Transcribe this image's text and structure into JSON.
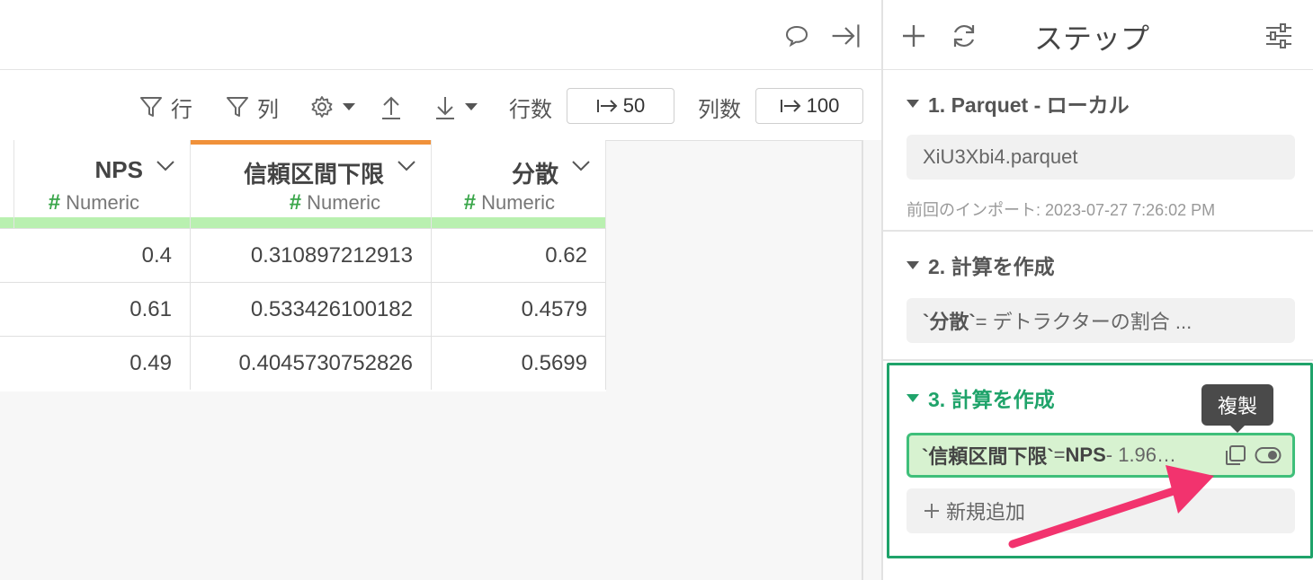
{
  "toolbar": {
    "filter_row_label": "行",
    "filter_col_label": "列",
    "row_count_label": "行数",
    "row_count_value": "50",
    "col_count_label": "列数",
    "col_count_value": "100"
  },
  "table": {
    "columns": [
      {
        "name": "NPS",
        "type": "Numeric"
      },
      {
        "name": "信頼区間下限",
        "type": "Numeric"
      },
      {
        "name": "分散",
        "type": "Numeric"
      }
    ],
    "rows": [
      [
        "0.4",
        "0.310897212913",
        "0.62"
      ],
      [
        "0.61",
        "0.533426100182",
        "0.4579"
      ],
      [
        "0.49",
        "0.4045730752826",
        "0.5699"
      ]
    ],
    "accent_colors": {
      "type_bar": "#b9f0b0",
      "selected_column": "#f0913a",
      "hash": "#3aa64a"
    }
  },
  "steps_panel": {
    "title": "ステップ",
    "steps": [
      {
        "header": "1. Parquet - ローカル",
        "content": "XiU3Xbi4.parquet",
        "note": "前回のインポート: 2023-07-27 7:26:02 PM"
      },
      {
        "header": "2. 計算を作成",
        "content_bold": "`分散`",
        "content_rest": " = デトラクターの割合 ..."
      },
      {
        "header": "3. 計算を作成",
        "content_bold": "`信頼区間下限`",
        "content_mid": " = ",
        "content_bold2": "NPS",
        "content_rest": " - 1.96…"
      }
    ],
    "tooltip": "複製",
    "add_label": "新規追加",
    "active_color": "#1fa36a"
  },
  "annotation": {
    "arrow_color": "#f2336e"
  }
}
